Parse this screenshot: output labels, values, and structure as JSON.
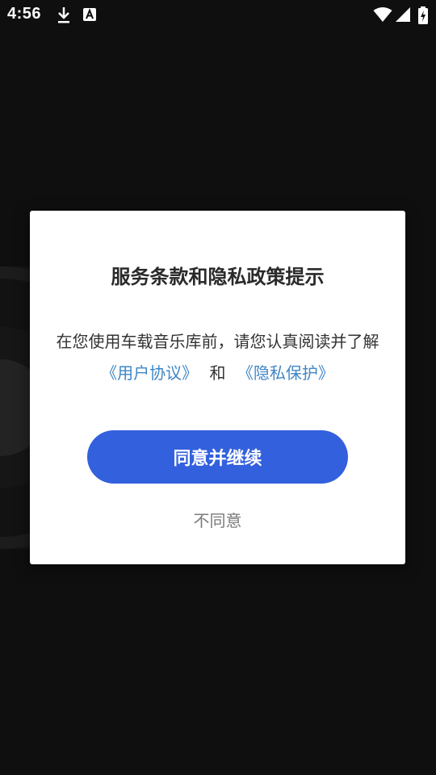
{
  "status_bar": {
    "time": "4:56",
    "icons": [
      "download-icon",
      "app-a-icon",
      "wifi-icon",
      "signal-icon",
      "battery-charging-icon"
    ]
  },
  "dialog": {
    "title": "服务条款和隐私政策提示",
    "message": "在您使用车载音乐库前，请您认真阅读并了解",
    "user_agreement_link": "《用户协议》",
    "connector": "和",
    "privacy_link": "《隐私保护》",
    "agree_label": "同意并继续",
    "disagree_label": "不同意"
  },
  "colors": {
    "background": "#0f0f0f",
    "dialog_background": "#ffffff",
    "link": "#3f86c5",
    "primary_button": "#3360dd",
    "secondary_text": "#7a7a7a"
  }
}
